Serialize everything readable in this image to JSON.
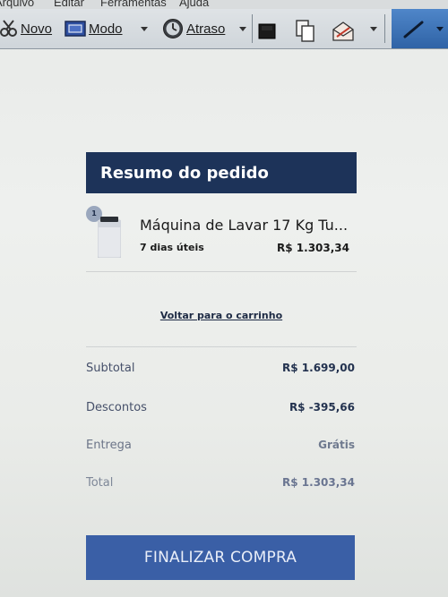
{
  "menubar": {
    "items": [
      "Arquivo",
      "Editar",
      "Ferramentas",
      "Ajuda"
    ]
  },
  "toolbar": {
    "new_label": "Novo",
    "mode_label": "Modo",
    "delay_label": "Atraso",
    "icons": [
      "snip-icon",
      "mode-icon",
      "clock-icon",
      "save-icon",
      "copy-icon",
      "send-icon",
      "pen-icon"
    ]
  },
  "order": {
    "header": "Resumo do pedido",
    "item": {
      "quantity": "1",
      "name": "Máquina de Lavar 17 Kg Tu...",
      "delivery_time": "7 dias úteis",
      "price": "R$ 1.303,34"
    },
    "back_link": "Voltar para o carrinho",
    "summary": [
      {
        "label": "Subtotal",
        "value": "R$ 1.699,00"
      },
      {
        "label": "Descontos",
        "value": "R$ -395,66"
      },
      {
        "label": "Entrega",
        "value": "Grátis"
      },
      {
        "label": "Total",
        "value": "R$ 1.303,34"
      }
    ],
    "checkout_label": "FINALIZAR COMPRA"
  },
  "colors": {
    "header_bg": "#1d3359",
    "button_bg": "#3a5fa6",
    "pen_highlight": "#3a70b5"
  }
}
